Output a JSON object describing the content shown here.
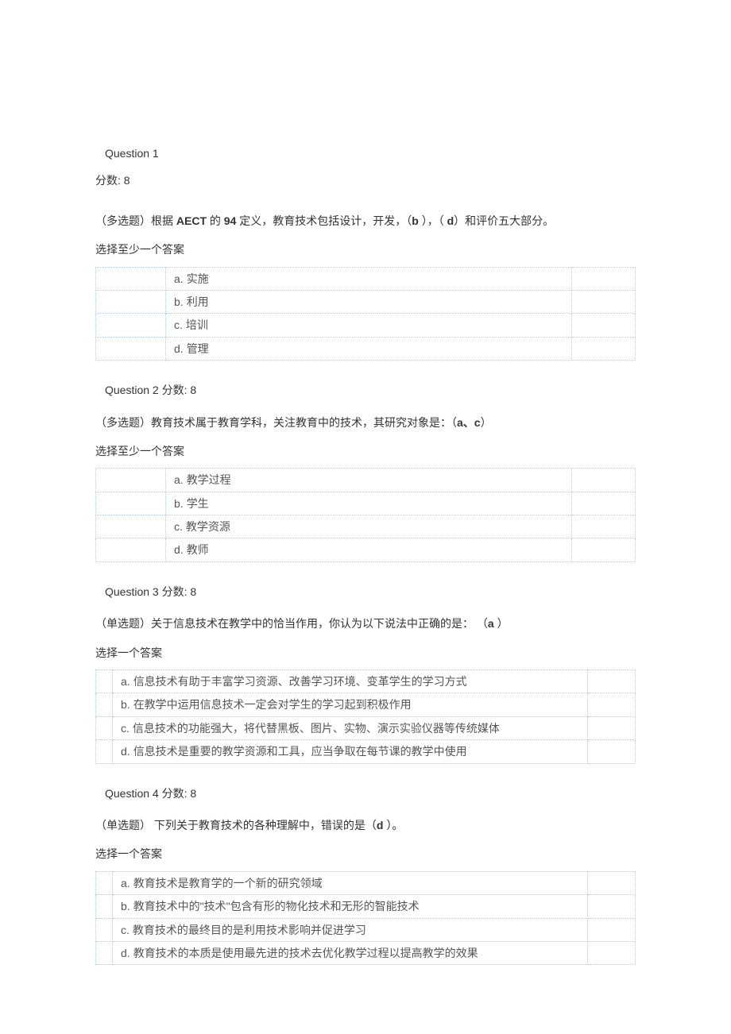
{
  "q1": {
    "title": "Question 1",
    "score_line": "分数: 8",
    "prefix": "（多选题）根据 ",
    "aect": "AECT",
    "mid1": " 的 ",
    "num": "94",
    "mid2": " 定义，教育技术包括设计，开发，（",
    "ans_b": "b",
    "mid3": " ），（ ",
    "ans_d": "d",
    "mid4": "）和评价五大部分。",
    "instr": "选择至少一个答案",
    "opts": [
      {
        "k": "a.",
        "t": "实施"
      },
      {
        "k": "b.",
        "t": "利用"
      },
      {
        "k": "c.",
        "t": "培训"
      },
      {
        "k": "d.",
        "t": "管理"
      }
    ]
  },
  "q2": {
    "title": "Question 2 分数: 8",
    "stem_pre": "（多选题）教育技术属于教育学科，关注教育中的技术，其研究对象是：（",
    "ans": "a、c",
    "stem_post": "）",
    "instr": "选择至少一个答案",
    "opts": [
      {
        "k": "a.",
        "t": "教学过程"
      },
      {
        "k": "b.",
        "t": "学生"
      },
      {
        "k": "c.",
        "t": "教学资源"
      },
      {
        "k": "d.",
        "t": "教师"
      }
    ]
  },
  "q3": {
    "title": "Question 3 分数: 8",
    "stem_pre": "（单选题）关于信息技术在教学中的恰当作用，你认为以下说法中正确的是：  （",
    "ans": "a",
    "stem_post": " ）",
    "instr": "选择一个答案",
    "opts": [
      {
        "k": "a.",
        "t": "信息技术有助于丰富学习资源、改善学习环境、变革学生的学习方式"
      },
      {
        "k": "b.",
        "t": "在教学中运用信息技术一定会对学生的学习起到积极作用"
      },
      {
        "k": "c.",
        "t": "信息技术的功能强大，将代替黑板、图片、实物、演示实验仪器等传统媒体"
      },
      {
        "k": "d.",
        "t": "信息技术是重要的教学资源和工具，应当争取在每节课的教学中使用"
      }
    ]
  },
  "q4": {
    "title": "Question 4 分数: 8",
    "stem_pre": "（单选题）  下列关于教育技术的各种理解中，错误的是（",
    "ans": "d",
    "stem_post": " ）。",
    "instr": "选择一个答案",
    "opts": [
      {
        "k": "a.",
        "t": "教育技术是教育学的一个新的研究领域"
      },
      {
        "k": "b.",
        "t": "教育技术中的\"技术\"包含有形的物化技术和无形的智能技术"
      },
      {
        "k": "c.",
        "t": "教育技术的最终目的是利用技术影响并促进学习"
      },
      {
        "k": "d.",
        "t": "教育技术的本质是使用最先进的技术去优化教学过程以提高教学的效果"
      }
    ]
  }
}
